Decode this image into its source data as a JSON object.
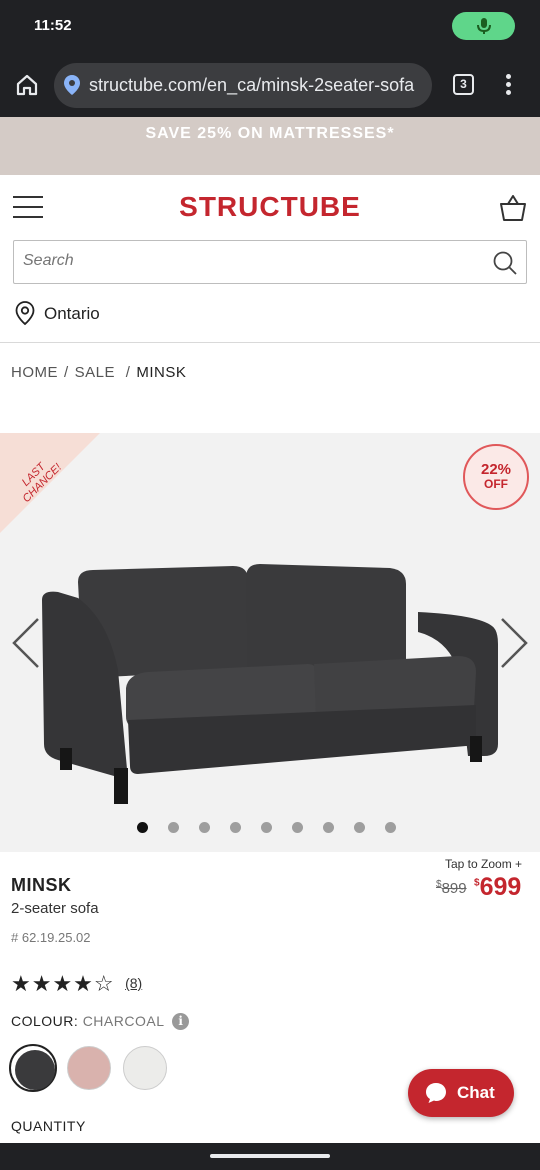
{
  "status_bar": {
    "time": "11:52"
  },
  "browser": {
    "url": "structube.com/en_ca/minsk-2seater-sofa",
    "tab_count": "3"
  },
  "promo": {
    "text": "SAVE 25% ON MATTRESSES*"
  },
  "header": {
    "logo": "STRUCTUBE",
    "search_placeholder": "Search",
    "location": "Ontario"
  },
  "breadcrumb": {
    "home": "HOME",
    "sale": "SALE",
    "current": "MINSK"
  },
  "gallery": {
    "ribbon": "LAST CHANCE!",
    "discount_pct": "22%",
    "discount_off": "OFF",
    "image_count": 9,
    "active_index": 0
  },
  "product": {
    "zoom_label": "Tap to Zoom +",
    "name": "MINSK",
    "description": "2-seater sofa",
    "sku": "# 62.19.25.02",
    "old_price_symbol": "$",
    "old_price": "899",
    "new_price_symbol": "$",
    "new_price": "699",
    "rating": 4,
    "rating_max": 5,
    "stars": "★★★★☆",
    "review_count": "(8)",
    "colour_label": "COLOUR:",
    "colour_value": "CHARCOAL",
    "swatches": [
      {
        "name": "charcoal",
        "color": "#3a3a3c"
      },
      {
        "name": "blush",
        "color": "#d9b2ad"
      },
      {
        "name": "white",
        "color": "#ececea"
      }
    ],
    "quantity_label": "QUANTITY"
  },
  "chat": {
    "label": "Chat"
  },
  "colors": {
    "brand_red": "#c4262e",
    "promo_bg": "#d4cbc6",
    "status_bg": "#202124"
  }
}
